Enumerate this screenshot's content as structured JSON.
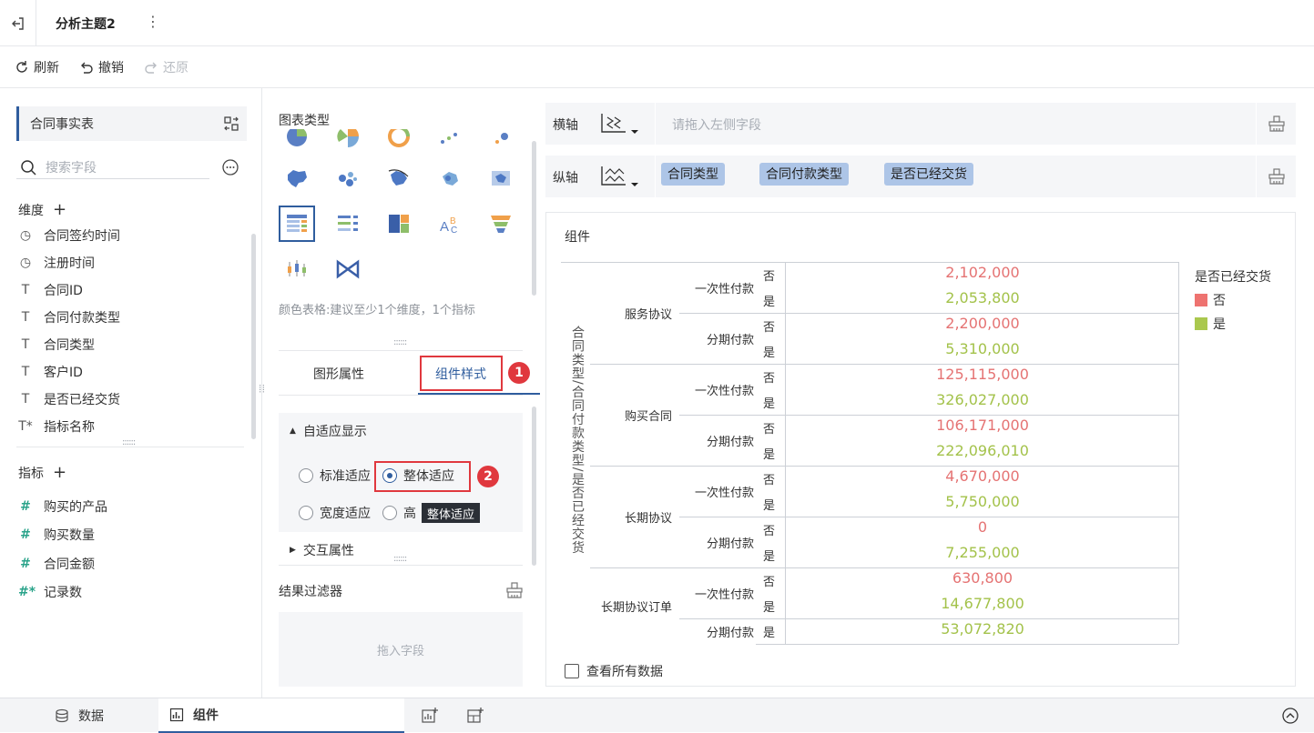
{
  "topbar": {
    "title": "分析主题2",
    "more": "⋮"
  },
  "toolbar": {
    "refresh": "刷新",
    "undo": "撤销",
    "redo": "还原"
  },
  "left": {
    "table": "合同事实表",
    "search_placeholder": "搜索字段",
    "dimension_header": "维度",
    "dimensions": [
      {
        "icon": "clock-icon",
        "label": "合同签约时间"
      },
      {
        "icon": "clock-icon",
        "label": "注册时间"
      },
      {
        "icon": "text-icon",
        "label": "合同ID"
      },
      {
        "icon": "text-icon",
        "label": "合同付款类型"
      },
      {
        "icon": "text-icon",
        "label": "合同类型"
      },
      {
        "icon": "text-icon",
        "label": "客户ID"
      },
      {
        "icon": "text-icon",
        "label": "是否已经交货"
      },
      {
        "icon": "text-star-icon",
        "label": "指标名称"
      }
    ],
    "measure_header": "指标",
    "measures": [
      {
        "icon": "hash-icon",
        "label": "购买的产品"
      },
      {
        "icon": "hash-icon",
        "label": "购买数量"
      },
      {
        "icon": "hash-icon",
        "label": "合同金额"
      },
      {
        "icon": "hash-star-icon",
        "label": "记录数"
      }
    ]
  },
  "middle": {
    "chart_type_label": "图表类型",
    "hint": "颜色表格:建议至少1个维度，1个指标",
    "tabs": [
      "图形属性",
      "组件样式"
    ],
    "active_tab": "组件样式",
    "badge1": "1",
    "badge2": "2",
    "adaptive_section": "自适应显示",
    "adaptive_options": [
      "标准适应",
      "整体适应",
      "宽度适应",
      "高"
    ],
    "adaptive_selected": "整体适应",
    "tooltip": "整体适应",
    "interaction_section": "交互属性",
    "filter_label": "结果过滤器",
    "drop_placeholder": "拖入字段"
  },
  "right": {
    "x_axis_label": "横轴",
    "x_axis_placeholder": "请拖入左侧字段",
    "y_axis_label": "纵轴",
    "y_axis_pills": [
      "合同类型",
      "合同付款类型",
      "是否已经交货"
    ],
    "component_title": "组件",
    "vertical_header": "合同类型/合同付款类型/是否已经交货",
    "legend_title": "是否已经交货",
    "legend": [
      {
        "label": "否",
        "color": "#ee7370"
      },
      {
        "label": "是",
        "color": "#aac84e"
      }
    ],
    "view_all": "查看所有数据"
  },
  "chart_data": {
    "type": "table",
    "rows": [
      {
        "contract_type": "服务协议",
        "payment_type": "一次性付款",
        "delivered": "否",
        "value": "2,102,000"
      },
      {
        "contract_type": "服务协议",
        "payment_type": "一次性付款",
        "delivered": "是",
        "value": "2,053,800"
      },
      {
        "contract_type": "服务协议",
        "payment_type": "分期付款",
        "delivered": "否",
        "value": "2,200,000"
      },
      {
        "contract_type": "服务协议",
        "payment_type": "分期付款",
        "delivered": "是",
        "value": "5,310,000"
      },
      {
        "contract_type": "购买合同",
        "payment_type": "一次性付款",
        "delivered": "否",
        "value": "125,115,000"
      },
      {
        "contract_type": "购买合同",
        "payment_type": "一次性付款",
        "delivered": "是",
        "value": "326,027,000"
      },
      {
        "contract_type": "购买合同",
        "payment_type": "分期付款",
        "delivered": "否",
        "value": "106,171,000"
      },
      {
        "contract_type": "购买合同",
        "payment_type": "分期付款",
        "delivered": "是",
        "value": "222,096,010"
      },
      {
        "contract_type": "长期协议",
        "payment_type": "一次性付款",
        "delivered": "否",
        "value": "4,670,000"
      },
      {
        "contract_type": "长期协议",
        "payment_type": "一次性付款",
        "delivered": "是",
        "value": "5,750,000"
      },
      {
        "contract_type": "长期协议",
        "payment_type": "分期付款",
        "delivered": "否",
        "value": "0"
      },
      {
        "contract_type": "长期协议",
        "payment_type": "分期付款",
        "delivered": "是",
        "value": "7,255,000"
      },
      {
        "contract_type": "长期协议订单",
        "payment_type": "一次性付款",
        "delivered": "否",
        "value": "630,800"
      },
      {
        "contract_type": "长期协议订单",
        "payment_type": "一次性付款",
        "delivered": "是",
        "value": "14,677,800"
      },
      {
        "contract_type": "长期协议订单",
        "payment_type": "分期付款",
        "delivered": "是",
        "value": "53,072,820"
      }
    ]
  },
  "bottom": {
    "tab_data": "数据",
    "tab_component": "组件"
  }
}
